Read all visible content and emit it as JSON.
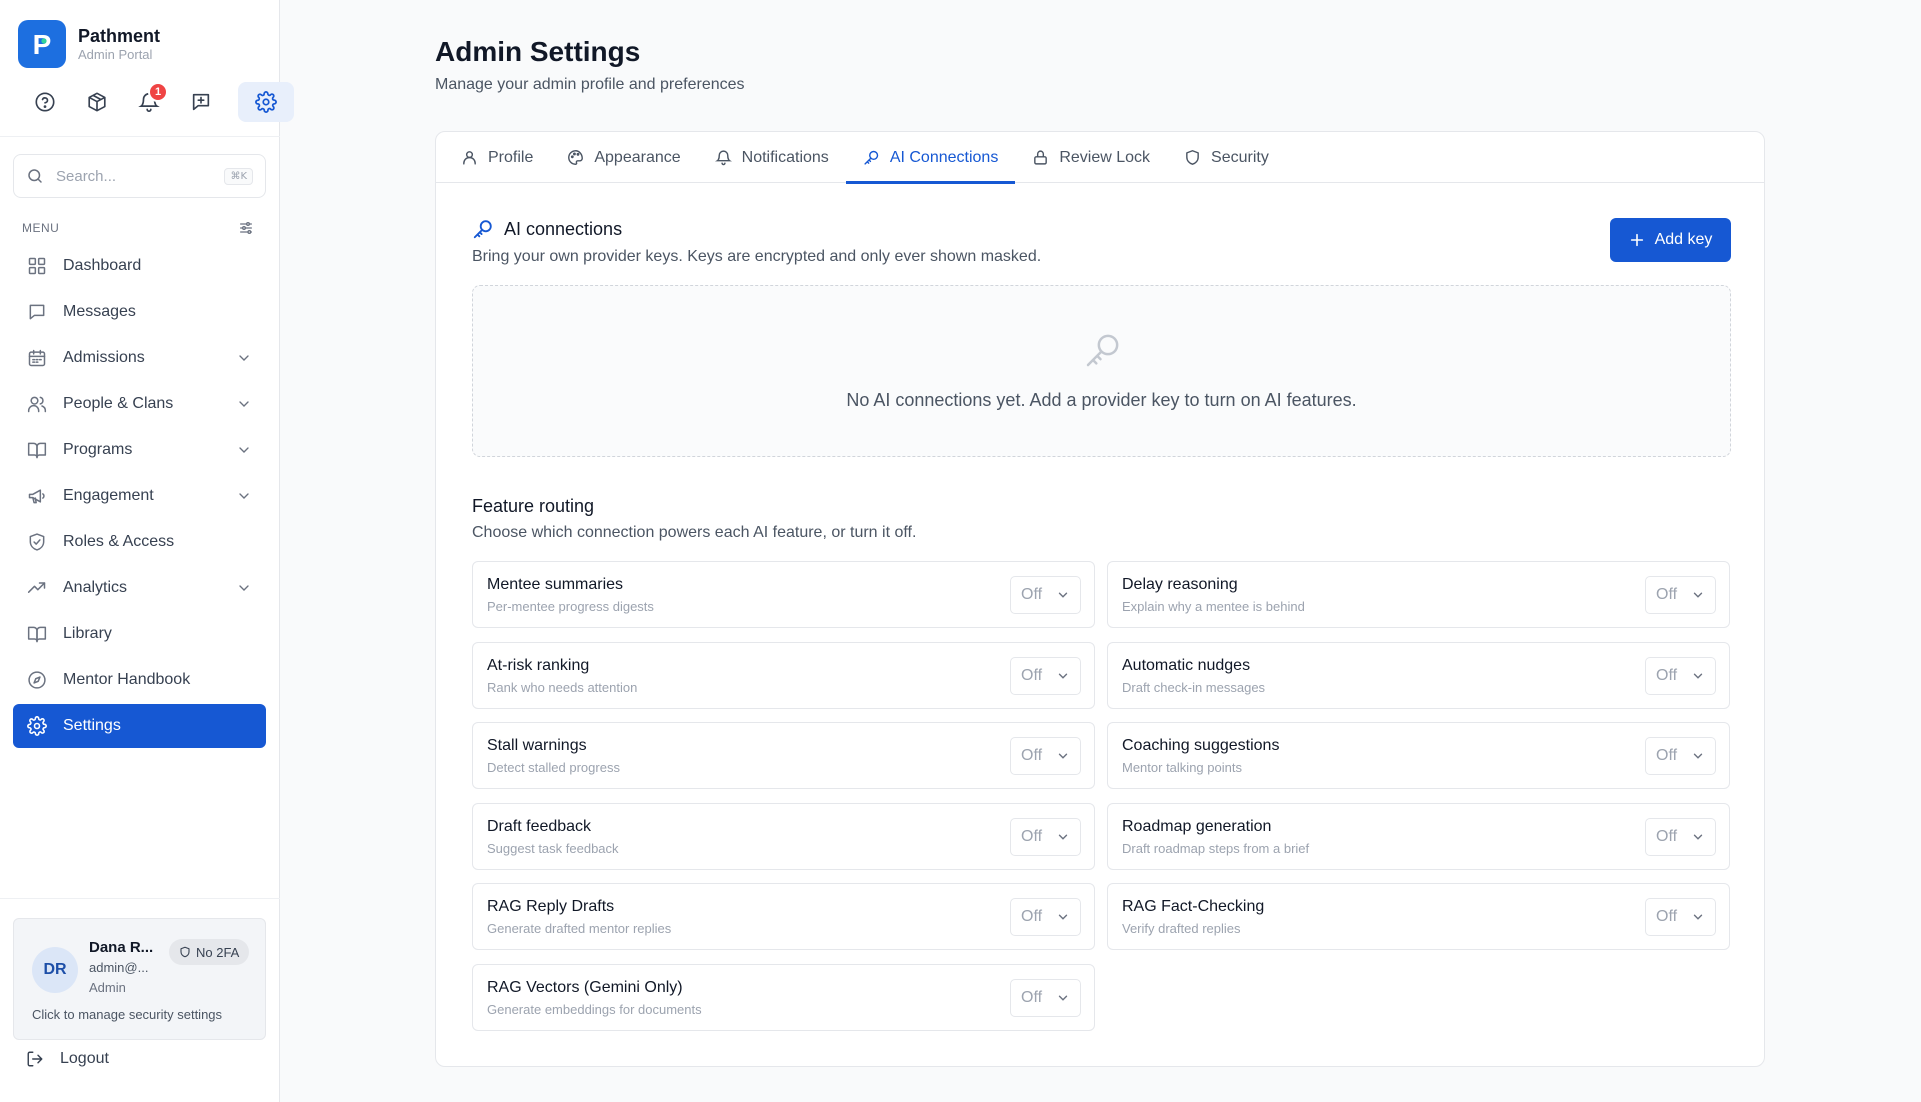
{
  "brand": {
    "name": "Pathment",
    "subtitle": "Admin Portal",
    "logo_letter": "P"
  },
  "quick_icons": [
    {
      "name": "help-icon"
    },
    {
      "name": "package-icon"
    },
    {
      "name": "bell-icon",
      "badge": "1"
    },
    {
      "name": "message-plus-icon"
    },
    {
      "name": "gear-icon",
      "active": true
    }
  ],
  "search": {
    "placeholder": "Search...",
    "shortcut": "⌘K"
  },
  "menu": {
    "label": "MENU",
    "items": [
      {
        "label": "Dashboard",
        "icon": "dashboard-icon",
        "chevron": false
      },
      {
        "label": "Messages",
        "icon": "chat-icon",
        "chevron": false
      },
      {
        "label": "Admissions",
        "icon": "calendar-icon",
        "chevron": true
      },
      {
        "label": "People & Clans",
        "icon": "users-icon",
        "chevron": true
      },
      {
        "label": "Programs",
        "icon": "book-open-icon",
        "chevron": true
      },
      {
        "label": "Engagement",
        "icon": "megaphone-icon",
        "chevron": true
      },
      {
        "label": "Roles & Access",
        "icon": "shield-check-icon",
        "chevron": false
      },
      {
        "label": "Analytics",
        "icon": "trend-up-icon",
        "chevron": true
      },
      {
        "label": "Library",
        "icon": "book-icon",
        "chevron": false
      },
      {
        "label": "Mentor Handbook",
        "icon": "compass-icon",
        "chevron": false
      },
      {
        "label": "Settings",
        "icon": "gear-icon",
        "chevron": false,
        "active": true
      }
    ]
  },
  "user": {
    "initials": "DR",
    "name": "Dana R...",
    "email": "admin@...",
    "role": "Admin",
    "twofa": "No 2FA",
    "hint": "Click to manage security settings"
  },
  "logout": "Logout",
  "page": {
    "title": "Admin Settings",
    "subtitle": "Manage your admin profile and preferences"
  },
  "tabs": [
    {
      "label": "Profile",
      "icon": "user-icon"
    },
    {
      "label": "Appearance",
      "icon": "palette-icon"
    },
    {
      "label": "Notifications",
      "icon": "bell-icon"
    },
    {
      "label": "AI Connections",
      "icon": "key-icon",
      "active": true
    },
    {
      "label": "Review Lock",
      "icon": "lock-icon"
    },
    {
      "label": "Security",
      "icon": "shield-icon"
    }
  ],
  "ai": {
    "title": "AI connections",
    "subtitle": "Bring your own provider keys. Keys are encrypted and only ever shown masked.",
    "add_button": "Add key",
    "empty_text": "No AI connections yet. Add a provider key to turn on AI features."
  },
  "routing": {
    "title": "Feature routing",
    "subtitle": "Choose which connection powers each AI feature, or turn it off.",
    "features": [
      {
        "title": "Mentee summaries",
        "desc": "Per-mentee progress digests",
        "value": "Off"
      },
      {
        "title": "Delay reasoning",
        "desc": "Explain why a mentee is behind",
        "value": "Off"
      },
      {
        "title": "At-risk ranking",
        "desc": "Rank who needs attention",
        "value": "Off"
      },
      {
        "title": "Automatic nudges",
        "desc": "Draft check-in messages",
        "value": "Off"
      },
      {
        "title": "Stall warnings",
        "desc": "Detect stalled progress",
        "value": "Off"
      },
      {
        "title": "Coaching suggestions",
        "desc": "Mentor talking points",
        "value": "Off"
      },
      {
        "title": "Draft feedback",
        "desc": "Suggest task feedback",
        "value": "Off"
      },
      {
        "title": "Roadmap generation",
        "desc": "Draft roadmap steps from a brief",
        "value": "Off"
      },
      {
        "title": "RAG Reply Drafts",
        "desc": "Generate drafted mentor replies",
        "value": "Off"
      },
      {
        "title": "RAG Fact-Checking",
        "desc": "Verify drafted replies",
        "value": "Off"
      },
      {
        "title": "RAG Vectors (Gemini Only)",
        "desc": "Generate embeddings for documents",
        "value": "Off"
      }
    ]
  },
  "colors": {
    "accent": "#1658d3",
    "badge": "#ef4444"
  }
}
